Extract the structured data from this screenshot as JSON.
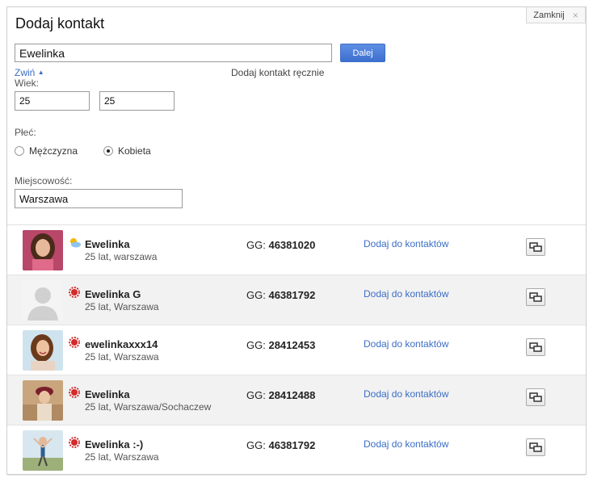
{
  "dialog": {
    "title": "Dodaj kontakt",
    "close_label": "Zamknij",
    "close_symbol": "×"
  },
  "search": {
    "value": "Ewelinka",
    "button_label": "Dalej",
    "collapse_label": "Zwiń",
    "manual_label": "Dodaj kontakt ręcznie"
  },
  "filters": {
    "age_label": "Wiek:",
    "age_from": "25",
    "age_to": "25",
    "gender_label": "Płeć:",
    "gender_options": [
      {
        "label": "Mężczyzna",
        "selected": false
      },
      {
        "label": "Kobieta",
        "selected": true
      }
    ],
    "city_label": "Miejscowość:",
    "city_value": "Warszawa"
  },
  "results": [
    {
      "name": "Ewelinka",
      "desc": "25 lat, warszawa",
      "gg_label": "GG:",
      "gg_number": "46381020",
      "add_label": "Dodaj do kontaktów",
      "status_icon": "sun-cloud-icon",
      "avatar": "photo-woman-pink"
    },
    {
      "name": "Ewelinka G",
      "desc": "25 lat, Warszawa",
      "gg_label": "GG:",
      "gg_number": "46381792",
      "add_label": "Dodaj do kontaktów",
      "status_icon": "red-sun-icon",
      "avatar": "placeholder-silhouette"
    },
    {
      "name": "ewelinkaxxx14",
      "desc": "25 lat, Warszawa",
      "gg_label": "GG:",
      "gg_number": "28412453",
      "add_label": "Dodaj do kontaktów",
      "status_icon": "red-sun-icon",
      "avatar": "photo-woman-smiling"
    },
    {
      "name": "Ewelinka",
      "desc": "25 lat, Warszawa/Sochaczew",
      "gg_label": "GG:",
      "gg_number": "28412488",
      "add_label": "Dodaj do kontaktów",
      "status_icon": "red-sun-icon",
      "avatar": "photo-woman-hat"
    },
    {
      "name": "Ewelinka :-)",
      "desc": "25 lat, Warszawa",
      "gg_label": "GG:",
      "gg_number": "46381792",
      "add_label": "Dodaj do kontaktów",
      "status_icon": "red-sun-icon",
      "avatar": "photo-woman-outdoor"
    }
  ],
  "colors": {
    "link": "#3b6ec5",
    "button": "#4a7bd8",
    "row_alt": "#f2f2f2",
    "status_busy": "#d42a2a"
  }
}
